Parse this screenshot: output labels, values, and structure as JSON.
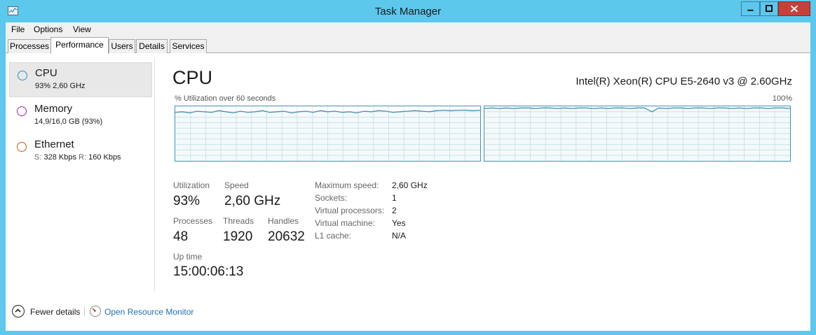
{
  "window": {
    "title": "Task Manager"
  },
  "menu": {
    "items": [
      "File",
      "Options",
      "View"
    ]
  },
  "tabs": [
    "Processes",
    "Performance",
    "Users",
    "Details",
    "Services"
  ],
  "active_tab": "Performance",
  "resources": [
    {
      "name": "CPU",
      "detail": "93%  2,60 GHz",
      "color": "#2f8fce"
    },
    {
      "name": "Memory",
      "detail": "14,9/16,0 GB (93%)",
      "color": "#9b2ea8"
    },
    {
      "name": "Ethernet",
      "send_label": "S:",
      "send_value": "328 Kbps",
      "recv_label": "R:",
      "recv_value": "160 Kbps",
      "color": "#c45a1a"
    }
  ],
  "cpu": {
    "heading": "CPU",
    "model": "Intel(R) Xeon(R) CPU E5-2640 v3 @ 2.60GHz",
    "graph_caption": "% Utilization over 60 seconds",
    "graph_max": "100%",
    "stats": {
      "utilization_label": "Utilization",
      "utilization_value": "93%",
      "speed_label": "Speed",
      "speed_value": "2,60 GHz",
      "processes_label": "Processes",
      "processes_value": "48",
      "threads_label": "Threads",
      "threads_value": "1920",
      "handles_label": "Handles",
      "handles_value": "20632",
      "uptime_label": "Up time",
      "uptime_value": "15:00:06:13"
    },
    "details": [
      {
        "key": "Maximum speed:",
        "value": "2,60 GHz"
      },
      {
        "key": "Sockets:",
        "value": "1"
      },
      {
        "key": "Virtual processors:",
        "value": "2"
      },
      {
        "key": "Virtual machine:",
        "value": "Yes"
      },
      {
        "key": "L1 cache:",
        "value": "N/A"
      }
    ]
  },
  "footer": {
    "fewer_details": "Fewer details",
    "open_resource_monitor": "Open Resource Monitor"
  },
  "colors": {
    "titlebar": "#5bc8ec",
    "graph_line": "#3f93b2",
    "graph_grid": "#d4e8f0",
    "link": "#1d6fb8",
    "close_button": "#c7413b"
  }
}
